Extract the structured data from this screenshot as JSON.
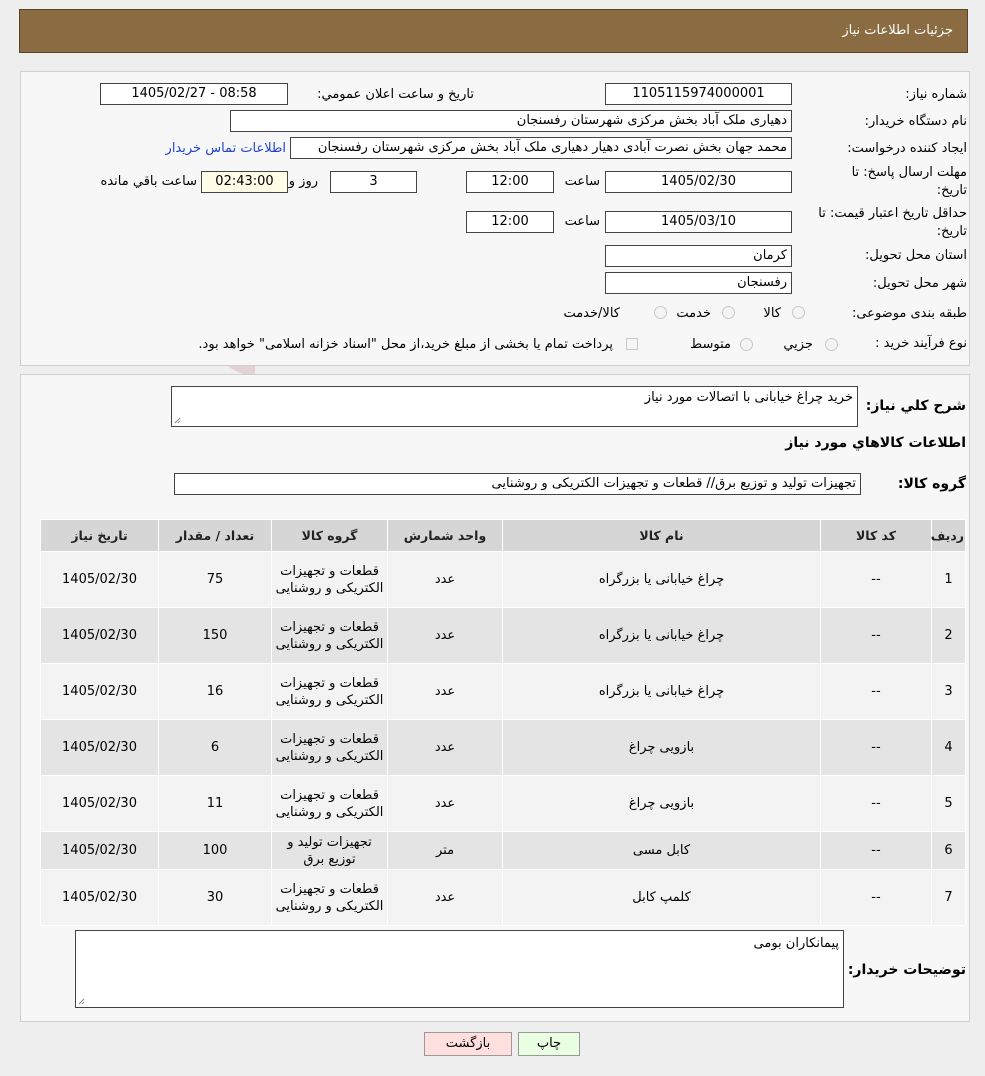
{
  "header": {
    "title": "جزئیات اطلاعات نیاز"
  },
  "form": {
    "need_number_label": "شماره نیاز:",
    "need_number": "1105115974000001",
    "announce_label": "تاریخ و ساعت اعلان عمومي:",
    "announce_value": "1405/02/27 - 08:58",
    "buyer_org_label": "نام دستگاه خريدار:",
    "buyer_org": "دهیاری ملک آباد بخش مرکزی شهرستان رفسنجان",
    "requester_label": "ايجاد کننده درخواست:",
    "requester": "محمد جهان بخش نصرت آبادی دهیار دهیاری ملک آباد بخش مرکزی شهرستان رفسنجان",
    "contact_link": "اطلاعات تماس خریدار",
    "deadline_label_1": "مهلت ارسال پاسخ: تا",
    "deadline_label_2": "تاریخ:",
    "deadline_date": "1405/02/30",
    "time_label": "ساعت",
    "deadline_time": "12:00",
    "days_value": "3",
    "days_label": "روز و",
    "remaining_time": "02:43:00",
    "remaining_label": "ساعت باقي مانده",
    "validity_label_1": "حداقل تاریخ اعتبار قیمت: تا",
    "validity_label_2": "تاریخ:",
    "validity_date": "1405/03/10",
    "validity_time_label": "ساعت",
    "validity_time": "12:00",
    "province_label": "استان محل تحويل:",
    "province": "کرمان",
    "city_label": "شهر محل تحويل:",
    "city": "رفسنجان",
    "category_label": "طبقه بندی موضوعی:",
    "category_options": [
      "کالا",
      "خدمت",
      "کالا/خدمت"
    ],
    "process_label": "نوع فرآيند خريد :",
    "process_options": [
      "جزيي",
      "متوسط"
    ],
    "payment_note": "پرداخت تمام یا بخشی از مبلغ خرید،از محل \"اسناد خزانه اسلامی\" خواهد بود."
  },
  "summary": {
    "desc_label": "شرح کلي نياز:",
    "desc_value": "خرید چراغ خیابانی با اتصالات مورد نیاز",
    "goods_info_title": "اطلاعات کالاهاي مورد نياز",
    "group_label": "گروه کالا:",
    "group_value": "تجهیزات تولید و توزیع برق// قطعات و تجهیزات الکتریکی و روشنایی"
  },
  "table": {
    "headers": [
      "رديف",
      "کد کالا",
      "نام کالا",
      "واحد شمارش",
      "گروه کالا",
      "تعداد / مقدار",
      "تاريخ نياز"
    ],
    "rows": [
      {
        "idx": "1",
        "code": "--",
        "name": "چراغ خیابانی یا بزرگراه",
        "unit": "عدد",
        "group": "قطعات و تجهیزات الکتریکی و روشنایی",
        "qty": "75",
        "date": "1405/02/30"
      },
      {
        "idx": "2",
        "code": "--",
        "name": "چراغ خیابانی یا بزرگراه",
        "unit": "عدد",
        "group": "قطعات و تجهیزات الکتریکی و روشنایی",
        "qty": "150",
        "date": "1405/02/30"
      },
      {
        "idx": "3",
        "code": "--",
        "name": "چراغ خیابانی یا بزرگراه",
        "unit": "عدد",
        "group": "قطعات و تجهیزات الکتریکی و روشنایی",
        "qty": "16",
        "date": "1405/02/30"
      },
      {
        "idx": "4",
        "code": "--",
        "name": "بازویی چراغ",
        "unit": "عدد",
        "group": "قطعات و تجهیزات الکتریکی و روشنایی",
        "qty": "6",
        "date": "1405/02/30"
      },
      {
        "idx": "5",
        "code": "--",
        "name": "بازویی چراغ",
        "unit": "عدد",
        "group": "قطعات و تجهیزات الکتریکی و روشنایی",
        "qty": "11",
        "date": "1405/02/30"
      },
      {
        "idx": "6",
        "code": "--",
        "name": "کابل مسی",
        "unit": "متر",
        "group": "تجهیزات تولید و توزیع برق",
        "qty": "100",
        "date": "1405/02/30"
      },
      {
        "idx": "7",
        "code": "--",
        "name": "کلمپ کابل",
        "unit": "عدد",
        "group": "قطعات و تجهیزات الکتریکی و روشنایی",
        "qty": "30",
        "date": "1405/02/30"
      }
    ]
  },
  "buyer_notes": {
    "label": "توضیحات خریدار:",
    "value": "پیمانکاران بومی"
  },
  "buttons": {
    "print": "چاپ",
    "back": "بازگشت"
  },
  "watermark": {
    "text": "AriaTender.neT"
  },
  "colors": {
    "header_bg": "#8b6c42",
    "print_bg": "#e8ffe2",
    "back_bg": "#ffdede",
    "link": "#2244cc"
  }
}
